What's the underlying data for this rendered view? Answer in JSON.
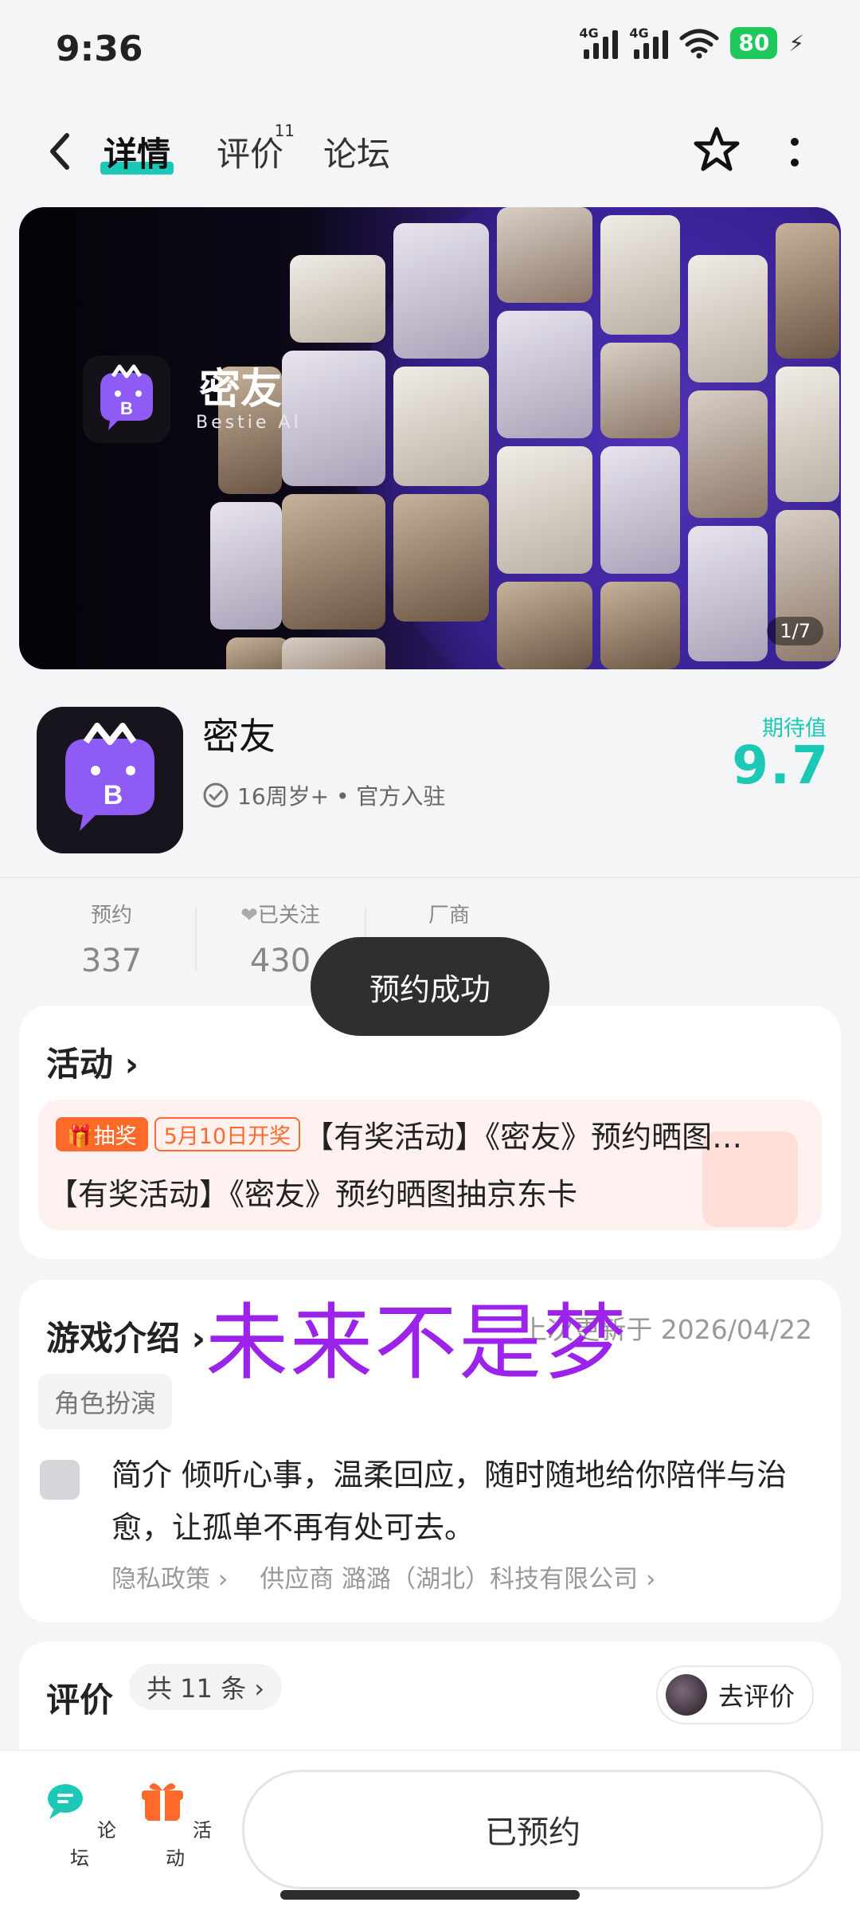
{
  "status_bar": {
    "time": "9:36",
    "signal1_label": "4G",
    "signal2_label": "4G",
    "battery": "80"
  },
  "nav": {
    "tabs": [
      {
        "label": "详情"
      },
      {
        "label": "评价",
        "badge": "11"
      },
      {
        "label": "论坛"
      }
    ]
  },
  "banner": {
    "app_name": "密友",
    "app_sub": "Bestie AI",
    "pager": "1/7"
  },
  "app": {
    "name": "密友",
    "meta": "16周岁+ • 官方入驻",
    "score_label": "期待值",
    "score": "9.7"
  },
  "stats": [
    {
      "label": "预约",
      "value": "337"
    },
    {
      "label": "已关注",
      "value": "430"
    },
    {
      "label": "厂商",
      "value": ""
    }
  ],
  "toast": "预约成功",
  "activity": {
    "title": "活动",
    "badge": "抽奖",
    "date_badge": "5月10日开奖",
    "line1": "【有奖活动】《密友》预约晒图…",
    "line2": "【有奖活动】《密友》预约晒图抽京东卡"
  },
  "intro": {
    "title": "游戏介绍",
    "overlay": "未来不是梦",
    "update": "上次更新于 2026/04/22",
    "tag": "角色扮演",
    "text": "简介 倾听心事，温柔回应，随时随地给你陪伴与治愈，让孤单不再有处可去。",
    "privacy": "隐私政策",
    "supplier": "供应商 潞潞（湖北）科技有限公司"
  },
  "reviews": {
    "title": "评价",
    "count": "共 11 条",
    "rate_button": "去评价"
  },
  "bottom": {
    "forum": "论坛",
    "activity": "活动",
    "reserved": "已预约"
  },
  "colors": {
    "accent": "#1cc9b6",
    "orange": "#ff6a2b",
    "overlay_purple": "#9b23ea"
  }
}
